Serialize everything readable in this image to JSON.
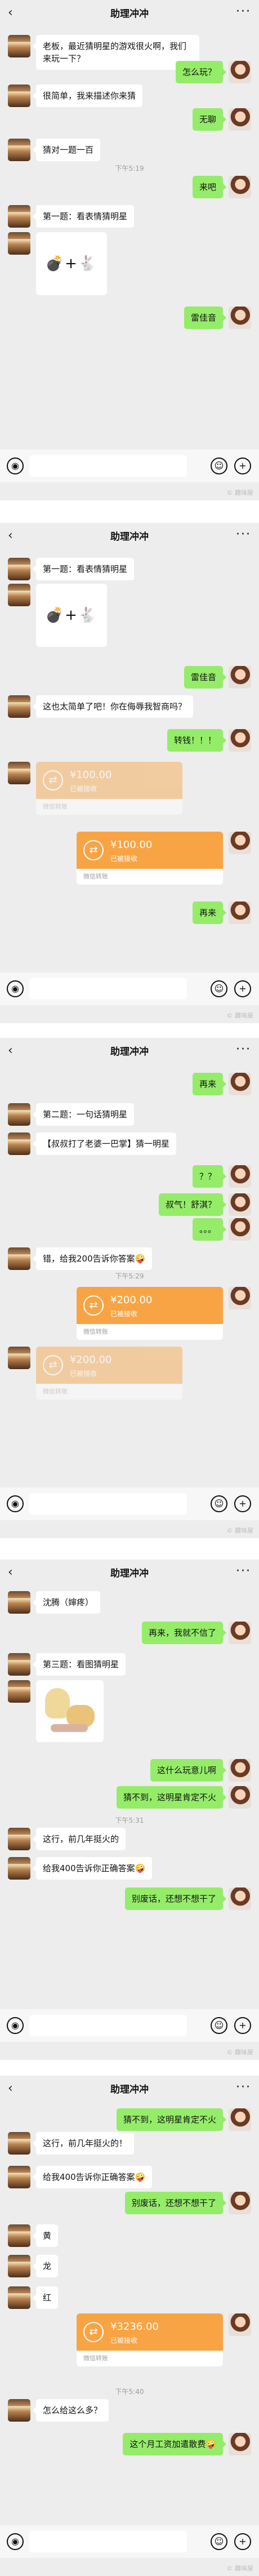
{
  "app": {
    "title": "助理冲冲",
    "back_icon": "chevron-left-icon",
    "more_icon": "more-dots-icon",
    "badge": ""
  },
  "colors": {
    "bg": "#ededed",
    "bubble_me": "#95ec69",
    "bubble_other": "#ffffff",
    "transfer": "#f8a444"
  },
  "transfer": {
    "unit": "¥",
    "sub_label": "已被接收",
    "footer": "微信转账"
  },
  "watermark": "© 趣味屋",
  "panel1": {
    "messages": [
      {
        "side": "left",
        "text": "老板，最近猜明星的游戏很火啊，我们来玩一下？"
      },
      {
        "side": "right",
        "text": "怎么玩？"
      },
      {
        "side": "left",
        "text": "很简单，我来描述你来猜"
      },
      {
        "side": "right",
        "text": "无聊"
      },
      {
        "side": "left",
        "text": "猜对一题一百"
      },
      {
        "time": "下午5:19"
      },
      {
        "side": "right",
        "text": "来吧"
      },
      {
        "side": "left",
        "text": "第一题：看表情猜明星"
      },
      {
        "side": "left",
        "emoji": "💣+🐇"
      },
      {
        "side": "right",
        "text": "雷佳音"
      }
    ]
  },
  "panel2": {
    "messages": [
      {
        "side": "left",
        "text": "第一题：看表情猜明星"
      },
      {
        "side": "left",
        "emoji": "💣+🐇"
      },
      {
        "side": "right",
        "text": "雷佳音"
      },
      {
        "side": "left",
        "text": "这也太简单了吧！你在侮辱我智商吗？"
      },
      {
        "side": "right",
        "text": "转钱！！！"
      },
      {
        "side": "left",
        "amount": "100.00"
      },
      {
        "side": "right",
        "amount": "100.00"
      },
      {
        "side": "right",
        "text": "再来"
      }
    ]
  },
  "panel3": {
    "messages": [
      {
        "side": "right",
        "text": "再来"
      },
      {
        "side": "left",
        "text": "第二题：一句话猜明星"
      },
      {
        "side": "left",
        "text": "【叔叔打了老婆一巴掌】猜一明星"
      },
      {
        "side": "right",
        "text": "？？"
      },
      {
        "side": "right",
        "text": "叔气！舒淇？"
      },
      {
        "side": "right",
        "text": "。。。"
      },
      {
        "side": "left",
        "text": "错，给我200告诉你答案🤪"
      },
      {
        "time": "下午5:29"
      },
      {
        "side": "right",
        "amount": "200.00"
      },
      {
        "side": "left",
        "amount": "200.00"
      }
    ]
  },
  "panel4": {
    "messages": [
      {
        "side": "left",
        "text": "沈腾（婶疼）"
      },
      {
        "side": "right",
        "text": "再来，我就不信了"
      },
      {
        "side": "left",
        "text": "第三题：看图猜明星"
      },
      {
        "side": "left",
        "image": true
      },
      {
        "side": "right",
        "text": "这什么玩意儿啊"
      },
      {
        "side": "right",
        "text": "猜不到，这明星肯定不火"
      },
      {
        "time": "下午5:31"
      },
      {
        "side": "left",
        "text": "这行，前几年挺火的"
      },
      {
        "side": "left",
        "text": "给我400告诉你正确答案🤪"
      },
      {
        "side": "right",
        "text": "别废话，还想不想干了"
      }
    ]
  },
  "panel5": {
    "messages": [
      {
        "side": "right",
        "text": "猜不到，这明星肯定不火"
      },
      {
        "side": "left",
        "text": "这行，前几年挺火的！"
      },
      {
        "side": "left",
        "text": "给我400告诉你正确答案🤪"
      },
      {
        "side": "right",
        "text": "别废话，还想不想干了"
      },
      {
        "side": "left",
        "text": "黄"
      },
      {
        "side": "left",
        "text": "龙"
      },
      {
        "side": "left",
        "text": "红"
      },
      {
        "side": "right",
        "amount": "3236.00",
        "big": true
      },
      {
        "time": "下午5:40"
      },
      {
        "side": "left",
        "text": "怎么给这么多？"
      },
      {
        "side": "right",
        "text": "这个月工资加遣散费🤪"
      }
    ]
  }
}
